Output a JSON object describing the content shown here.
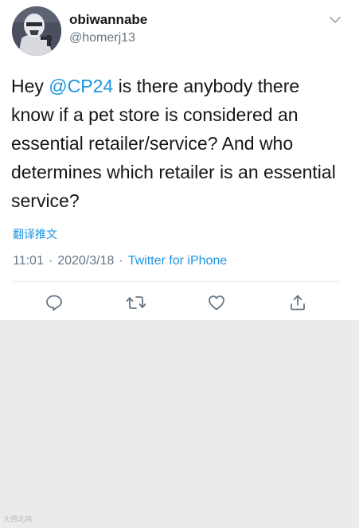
{
  "tweet": {
    "display_name": "obiwannabe",
    "handle": "@homerj13",
    "text_before": "Hey ",
    "mention": "@CP24",
    "text_after": " is there anybody there know if a pet store is considered an essential retailer/service? And who determines which retailer is an essential service?",
    "translate_label": "翻译推文",
    "time": "11:01",
    "date": "2020/3/18",
    "separator": "·",
    "source": "Twitter for iPhone"
  },
  "actions": [
    {
      "name": "reply-icon"
    },
    {
      "name": "retweet-icon"
    },
    {
      "name": "like-icon"
    },
    {
      "name": "share-icon"
    }
  ],
  "watermark": "大西北网",
  "colors": {
    "link": "#1b95e0",
    "secondary_text": "#657786",
    "primary_text": "#14171a",
    "background": "#ebebee"
  }
}
